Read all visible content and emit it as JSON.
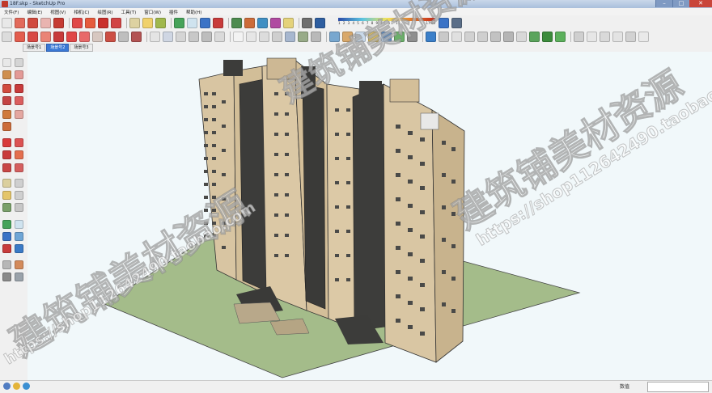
{
  "window": {
    "title": "18F.skp - SketchUp Pro",
    "controls": {
      "minimize": "–",
      "maximize": "□",
      "close": "✕"
    }
  },
  "menu": [
    "文件(F)",
    "编辑(E)",
    "视图(V)",
    "相机(C)",
    "绘图(R)",
    "工具(T)",
    "窗口(W)",
    "插件",
    "帮助(H)"
  ],
  "toolbar": {
    "shadow_time_scale": "1 2 3 4 5 6 7 8 9 10 11 12",
    "shadow_time_left": "06:58",
    "shadow_time_right": "17:00",
    "shadow_time_noon": "中午"
  },
  "scene_tabs": [
    {
      "label": "场景号1",
      "active": false
    },
    {
      "label": "场景号2",
      "active": true
    },
    {
      "label": "场景号3",
      "active": false
    }
  ],
  "statusbar": {
    "measurements_label": "数值"
  },
  "watermark": {
    "cn_text": "建筑铺美材资源",
    "url_text": "https://shop112642490.taobao.com",
    "url_text_short": "https://shop112642490.taobao.com"
  },
  "colors": {
    "sky": "#f1f8fa",
    "ground": "#a4bc8a",
    "facade": "#d9c6a4",
    "dark_panel": "#3c3c3a",
    "accent_selected_tab": "#3a78d4"
  }
}
